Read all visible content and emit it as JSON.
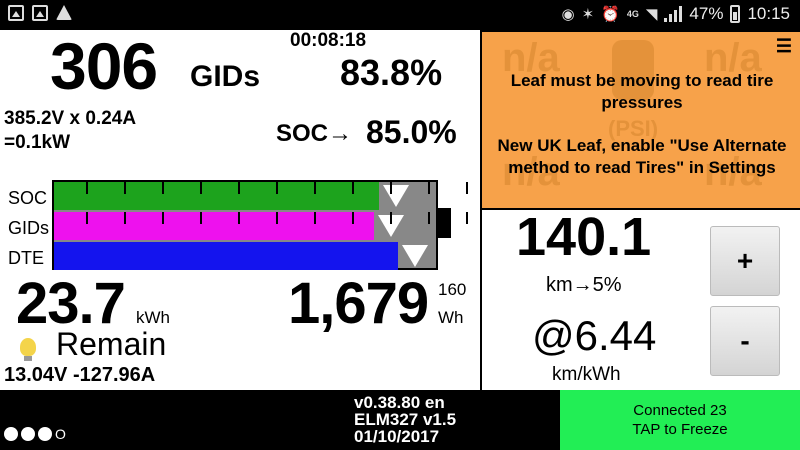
{
  "statusbar": {
    "network": "4G",
    "battery": "47%",
    "time": "10:15",
    "icons": [
      "gallery-icon",
      "image-icon",
      "warning-icon",
      "location-icon",
      "bluetooth-icon",
      "alarm-icon",
      "wifi-icon",
      "signal-icon",
      "battery-icon"
    ]
  },
  "main": {
    "gids_value": "306",
    "gids_unit": "GIDs",
    "timer": "00:08:18",
    "gids_pct": "83.8%",
    "volt_amp": "385.2V x 0.24A",
    "power": "=0.1kW",
    "soc_label": "SOC→",
    "soc_value": "85.0%",
    "bars": {
      "labels": [
        "SOC",
        "GIDs",
        "DTE"
      ],
      "end_label": "160",
      "soc_fraction": 0.85,
      "gids_fraction": 0.838,
      "dte_fraction": 0.9,
      "colors": {
        "soc": "#1da31d",
        "gids": "#ee11ee",
        "dte": "#1414ee"
      }
    },
    "kwh_value": "23.7",
    "kwh_unit": "kWh",
    "wh_value": "1,679",
    "wh_unit": "Wh",
    "remain_label": "Remain",
    "volt_current": "13.04V -127.96A"
  },
  "tire": {
    "placeholder": "n/a",
    "psi_label": "(PSI)",
    "menu_icon": "☰",
    "message1": "Leaf must be moving to read tire pressures",
    "message2": "New UK Leaf, enable \"Use Alternate method to read Tires\" in Settings"
  },
  "range": {
    "value": "140.1",
    "sub": "km→5%",
    "efficiency": "@6.44",
    "efficiency_unit": "km/kWh",
    "plus_label": "+",
    "minus_label": "-"
  },
  "footer": {
    "version": "v0.38.80 en",
    "adapter": "ELM327 v1.5",
    "date": "01/10/2017",
    "dots_suffix": "O",
    "connection": "Connected 23",
    "tap_hint": "TAP to Freeze"
  }
}
